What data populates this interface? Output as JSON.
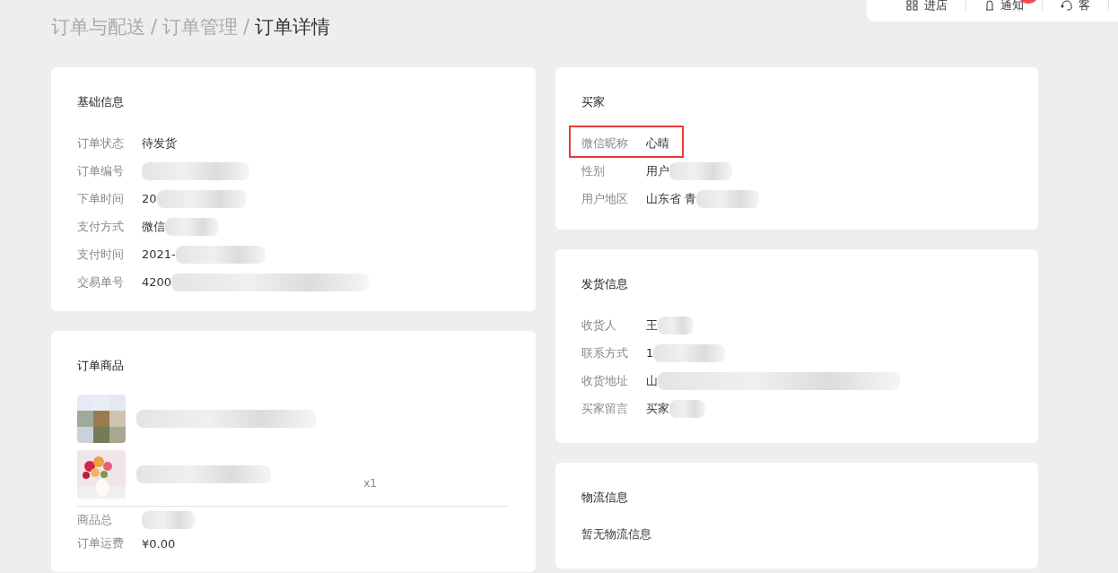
{
  "breadcrumb": [
    "订单与配送",
    "订单管理",
    "订单详情"
  ],
  "breadcrumb_separator": "/",
  "toolbar": [
    {
      "kind": "store",
      "label": "进店"
    },
    {
      "kind": "bell",
      "label": "通知",
      "badge": true
    },
    {
      "kind": "headset",
      "label": "客"
    }
  ],
  "basic_info": {
    "title": "基础信息",
    "rows": [
      {
        "label": "订单状态",
        "value": "待发货",
        "redacted": false
      },
      {
        "label": "订单编号",
        "redacted": true
      },
      {
        "label": "下单时间",
        "value": "20",
        "redacted": true
      },
      {
        "label": "支付方式",
        "value": "微信",
        "redacted": true
      },
      {
        "label": "支付时间",
        "value": "2021-",
        "redacted": true
      },
      {
        "label": "交易单号",
        "value": "4200",
        "redacted": true
      }
    ]
  },
  "order_items": {
    "title": "订单商品",
    "items": [
      {
        "kind": "mosaic"
      },
      {
        "kind": "flowers",
        "quantity": "x1"
      }
    ],
    "totals": [
      {
        "label": "商品总",
        "redacted": true
      },
      {
        "label": "订单运费",
        "value": "¥0.00",
        "redacted": false
      }
    ]
  },
  "buyer": {
    "title": "买家",
    "rows": [
      {
        "label": "微信昵称",
        "value": "心晴",
        "redacted": false,
        "highlighted": true
      },
      {
        "label": "性别",
        "value": "用户",
        "redacted": true
      },
      {
        "label": "用户地区",
        "value": "山东省 青",
        "redacted": true
      }
    ]
  },
  "shipping": {
    "title": "发货信息",
    "rows": [
      {
        "label": "收货人",
        "value": "王",
        "redacted": true
      },
      {
        "label": "联系方式",
        "value": "1",
        "redacted": true
      },
      {
        "label": "收货地址",
        "value": "山",
        "redacted": true
      },
      {
        "label": "买家留言",
        "value": "买家",
        "redacted": true
      }
    ]
  },
  "logistics": {
    "title": "物流信息",
    "message": "暂无物流信息"
  }
}
